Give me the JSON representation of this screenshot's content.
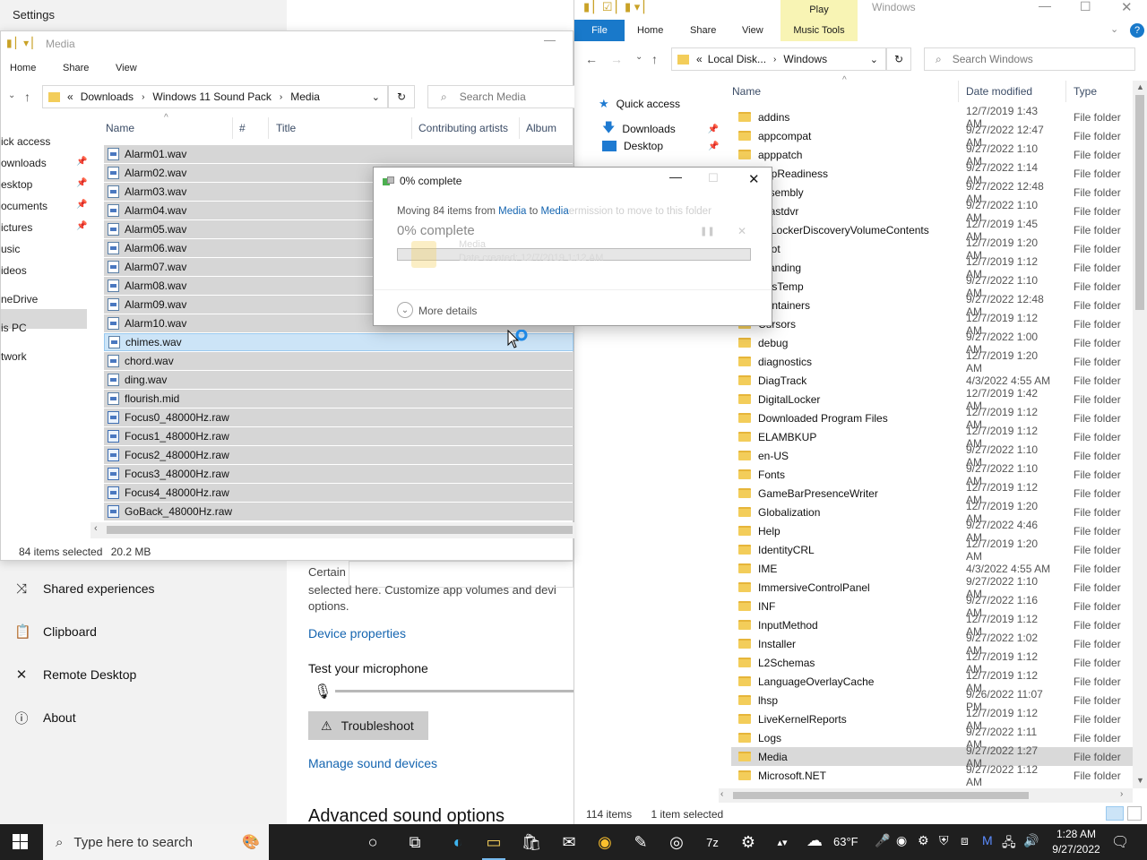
{
  "settings": {
    "title": "Settings",
    "nav": [
      {
        "label": "Shared experiences",
        "icon": "share-icon"
      },
      {
        "label": "Clipboard",
        "icon": "clipboard-icon"
      },
      {
        "label": "Remote Desktop",
        "icon": "remote-desktop-icon"
      },
      {
        "label": "About",
        "icon": "info-icon"
      }
    ],
    "certain_text": "Certain",
    "description": "selected here. Customize app volumes and devi",
    "description2": "options.",
    "device_properties": "Device properties",
    "test_mic": "Test your microphone",
    "troubleshoot": "Troubleshoot",
    "manage_devices": "Manage sound devices",
    "advanced_title": "Advanced sound options"
  },
  "media_window": {
    "title": "Media",
    "tabs": [
      "Home",
      "Share",
      "View"
    ],
    "breadcrumb": [
      "Downloads",
      "Windows 11 Sound Pack",
      "Media"
    ],
    "search_placeholder": "Search Media",
    "columns": [
      "Name",
      "#",
      "Title",
      "Contributing artists",
      "Album"
    ],
    "sidebar": [
      "ick access",
      "ownloads",
      "esktop",
      "ocuments",
      "ictures",
      "usic",
      "ideos",
      "neDrive",
      "is PC",
      "twork"
    ],
    "files": [
      "Alarm01.wav",
      "Alarm02.wav",
      "Alarm03.wav",
      "Alarm04.wav",
      "Alarm05.wav",
      "Alarm06.wav",
      "Alarm07.wav",
      "Alarm08.wav",
      "Alarm09.wav",
      "Alarm10.wav",
      "chimes.wav",
      "chord.wav",
      "ding.wav",
      "flourish.mid",
      "Focus0_48000Hz.raw",
      "Focus1_48000Hz.raw",
      "Focus2_48000Hz.raw",
      "Focus3_48000Hz.raw",
      "Focus4_48000Hz.raw",
      "GoBack_48000Hz.raw"
    ],
    "status_count": "84 items selected",
    "status_size": "20.2 MB"
  },
  "windows_window": {
    "title": "Windows",
    "context_tab": "Play",
    "tabs": [
      "File",
      "Home",
      "Share",
      "View",
      "Music Tools"
    ],
    "breadcrumb": [
      "Local Disk...",
      "Windows"
    ],
    "search_placeholder": "Search Windows",
    "columns": [
      "Name",
      "Date modified",
      "Type"
    ],
    "quick_access": [
      {
        "label": "Quick access",
        "icon": "star-icon"
      },
      {
        "label": "Downloads",
        "icon": "download-arrow-icon"
      },
      {
        "label": "Desktop",
        "icon": "desktop-icon"
      }
    ],
    "folders": [
      {
        "name": "addins",
        "date": "12/7/2019 1:43 AM",
        "type": "File folder"
      },
      {
        "name": "appcompat",
        "date": "9/27/2022 12:47 AM",
        "type": "File folder"
      },
      {
        "name": "apppatch",
        "date": "9/27/2022 1:10 AM",
        "type": "File folder"
      },
      {
        "name": "AppReadiness",
        "date": "9/27/2022 1:14 AM",
        "type": "File folder"
      },
      {
        "name": "assembly",
        "date": "9/27/2022 12:48 AM",
        "type": "File folder"
      },
      {
        "name": "bcastdvr",
        "date": "9/27/2022 1:10 AM",
        "type": "File folder"
      },
      {
        "name": "BitLockerDiscoveryVolumeContents",
        "date": "12/7/2019 1:45 AM",
        "type": "File folder"
      },
      {
        "name": "Boot",
        "date": "12/7/2019 1:20 AM",
        "type": "File folder"
      },
      {
        "name": "Branding",
        "date": "12/7/2019 1:12 AM",
        "type": "File folder"
      },
      {
        "name": "CbsTemp",
        "date": "9/27/2022 1:10 AM",
        "type": "File folder"
      },
      {
        "name": "Containers",
        "date": "9/27/2022 12:48 AM",
        "type": "File folder"
      },
      {
        "name": "Cursors",
        "date": "12/7/2019 1:12 AM",
        "type": "File folder"
      },
      {
        "name": "debug",
        "date": "9/27/2022 1:00 AM",
        "type": "File folder"
      },
      {
        "name": "diagnostics",
        "date": "12/7/2019 1:20 AM",
        "type": "File folder"
      },
      {
        "name": "DiagTrack",
        "date": "4/3/2022 4:55 AM",
        "type": "File folder"
      },
      {
        "name": "DigitalLocker",
        "date": "12/7/2019 1:42 AM",
        "type": "File folder"
      },
      {
        "name": "Downloaded Program Files",
        "date": "12/7/2019 1:12 AM",
        "type": "File folder"
      },
      {
        "name": "ELAMBKUP",
        "date": "12/7/2019 1:12 AM",
        "type": "File folder"
      },
      {
        "name": "en-US",
        "date": "9/27/2022 1:10 AM",
        "type": "File folder"
      },
      {
        "name": "Fonts",
        "date": "9/27/2022 1:10 AM",
        "type": "File folder"
      },
      {
        "name": "GameBarPresenceWriter",
        "date": "12/7/2019 1:12 AM",
        "type": "File folder"
      },
      {
        "name": "Globalization",
        "date": "12/7/2019 1:20 AM",
        "type": "File folder"
      },
      {
        "name": "Help",
        "date": "9/27/2022 4:46 AM",
        "type": "File folder"
      },
      {
        "name": "IdentityCRL",
        "date": "12/7/2019 1:20 AM",
        "type": "File folder"
      },
      {
        "name": "IME",
        "date": "4/3/2022 4:55 AM",
        "type": "File folder"
      },
      {
        "name": "ImmersiveControlPanel",
        "date": "9/27/2022 1:10 AM",
        "type": "File folder"
      },
      {
        "name": "INF",
        "date": "9/27/2022 1:16 AM",
        "type": "File folder"
      },
      {
        "name": "InputMethod",
        "date": "12/7/2019 1:12 AM",
        "type": "File folder"
      },
      {
        "name": "Installer",
        "date": "9/27/2022 1:02 AM",
        "type": "File folder"
      },
      {
        "name": "L2Schemas",
        "date": "12/7/2019 1:12 AM",
        "type": "File folder"
      },
      {
        "name": "LanguageOverlayCache",
        "date": "12/7/2019 1:12 AM",
        "type": "File folder"
      },
      {
        "name": "lhsp",
        "date": "9/26/2022 11:07 PM",
        "type": "File folder"
      },
      {
        "name": "LiveKernelReports",
        "date": "12/7/2019 1:12 AM",
        "type": "File folder"
      },
      {
        "name": "Logs",
        "date": "9/27/2022 1:11 AM",
        "type": "File folder"
      },
      {
        "name": "Media",
        "date": "9/27/2022 1:27 AM",
        "type": "File folder"
      },
      {
        "name": "Microsoft.NET",
        "date": "9/27/2022 1:12 AM",
        "type": "File folder"
      }
    ],
    "status_count": "114 items",
    "status_selected": "1 item selected"
  },
  "progress_dialog": {
    "title": "0% complete",
    "moving_text": "Moving 84 items from ",
    "from": "Media",
    "to_word": " to ",
    "to": "Media",
    "ghost_text": "ermission to move to this folder",
    "percent_text": "0% complete",
    "ghost_name": "Media",
    "ghost_date": "Date created: 12/7/2019 1:12 AM",
    "more_details": "More details",
    "progress": 0.0
  },
  "taskbar": {
    "search_placeholder": "Type here to search",
    "weather": "63°F",
    "time": "1:28 AM",
    "date": "9/27/2022"
  },
  "colors": {
    "accent_blue": "#0063b1",
    "selection": "#cce4f7",
    "link": "#1565b0",
    "taskbar": "#1f1f1f"
  }
}
